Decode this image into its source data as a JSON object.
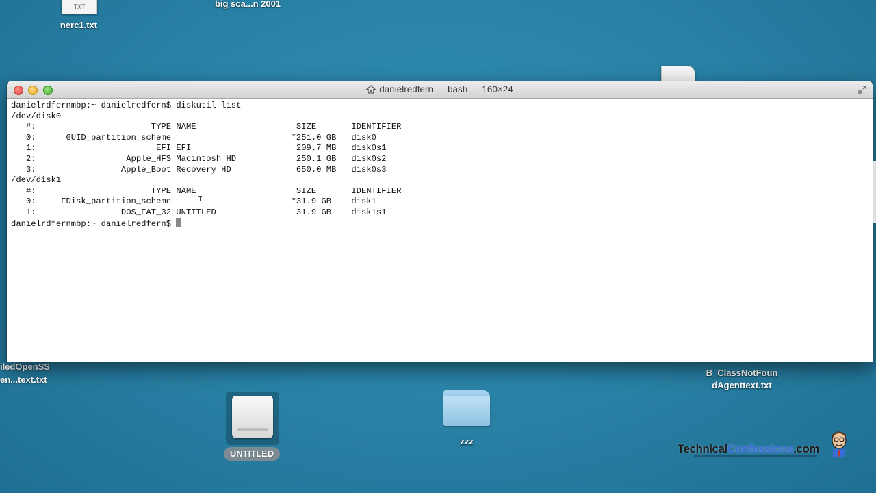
{
  "desktop": {
    "top_file_label": "nerc1.txt",
    "top_file_tag": "TXT",
    "top_folder_label": "big sca...n 2001",
    "left_label_1": "iledOpenSS",
    "left_label_2": "en...text.txt",
    "right_label_1": "B_ClassNotFoun",
    "right_label_2": "dAgenttext.txt",
    "drive_label": "UNTITLED",
    "folder_label": "zzz",
    "watermark": "TechnicalConfessions.com",
    "watermark_part1": "Technical",
    "watermark_part2": "Confessions",
    "watermark_part3": ".com"
  },
  "window": {
    "title": "danielredfern — bash — 160×24"
  },
  "terminal": {
    "lines": [
      "danielrdfernmbp:~ danielredfern$ diskutil list",
      "/dev/disk0",
      "   #:                       TYPE NAME                    SIZE       IDENTIFIER",
      "   0:      GUID_partition_scheme                        *251.0 GB   disk0",
      "   1:                        EFI EFI                     209.7 MB   disk0s1",
      "   2:                  Apple_HFS Macintosh HD            250.1 GB   disk0s2",
      "   3:                 Apple_Boot Recovery HD             650.0 MB   disk0s3",
      "/dev/disk1",
      "   #:                       TYPE NAME                    SIZE       IDENTIFIER",
      "   0:     FDisk_partition_scheme                        *31.9 GB    disk1",
      "   1:                 DOS_FAT_32 UNTITLED                31.9 GB    disk1s1"
    ],
    "prompt": "danielrdfernmbp:~ danielredfern$ "
  }
}
